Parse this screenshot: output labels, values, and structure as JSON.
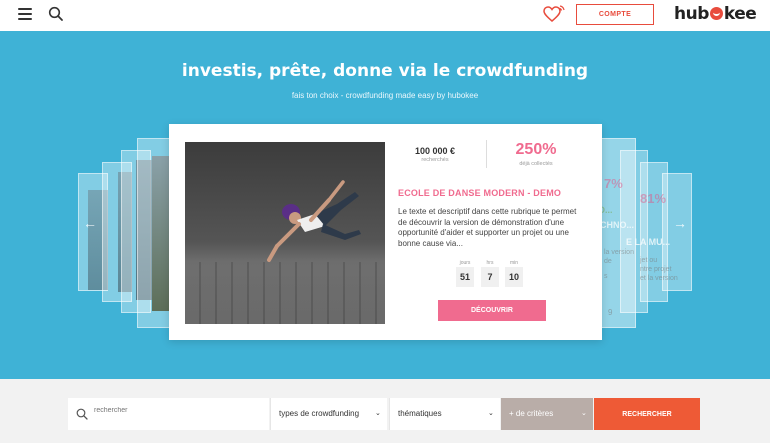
{
  "header": {
    "account_label": "COMPTE",
    "logo_text_left": "hub",
    "logo_text_right": "kee",
    "icons": [
      "menu-icon",
      "search-icon",
      "heart-notification-icon"
    ]
  },
  "hero": {
    "title": "investis, prête, donne via le crowdfunding",
    "subtitle": "fais ton choix - crowdfunding made easy by hubokee"
  },
  "ghost_card": {
    "pct_a": "7%",
    "pct_b": "81%",
    "word_a": "O...",
    "word_b": "CHNO...",
    "word_c": "E LA MU...",
    "lines": [
      "la version",
      "de",
      "jet ou",
      "ntre projet",
      "et la version",
      "s"
    ],
    "num": "9"
  },
  "card": {
    "amount": "100 000 €",
    "amount_label": "recherchés",
    "percent": "250%",
    "percent_label": "déjà collectés",
    "title": "ECOLE DE DANSE MODERN - DEMO",
    "description": "Le texte et descriptif dans cette rubrique te permet de découvrir la version de démonstration d'une opportunité d'aider et supporter un projet ou une bonne cause via...",
    "timer": [
      {
        "label": "jours",
        "value": "51"
      },
      {
        "label": "hrs",
        "value": "7"
      },
      {
        "label": "min",
        "value": "10"
      }
    ],
    "cta_label": "DÉCOUVRIR"
  },
  "search_bar": {
    "placeholder": "rechercher",
    "types_label": "types de crowdfunding",
    "themes_label": "thématiques",
    "criteria_label": "+ de critères",
    "submit_label": "RECHERCHER"
  },
  "colors": {
    "hero_bg": "#3fb2d6",
    "accent_pink": "#f06b8f",
    "accent_red": "#e84c3d",
    "search_button": "#ee5a36",
    "criteria_bg": "#b9ada8"
  }
}
